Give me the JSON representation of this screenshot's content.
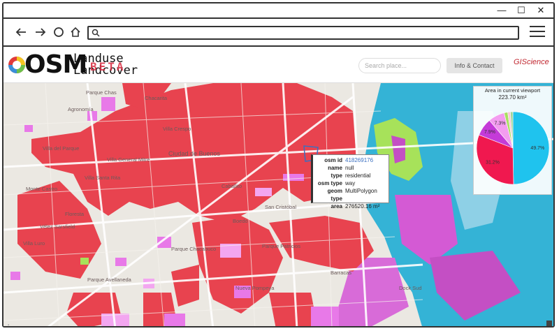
{
  "window": {
    "controls": [
      "—",
      "☐",
      "✕"
    ]
  },
  "browser": {
    "url": ""
  },
  "header": {
    "logo_osm": "OSM",
    "logo_line1": "Landuse",
    "logo_line2": "Landcover",
    "logo_beta": "BETA",
    "search_placeholder": "Search place...",
    "info_button": "Info & Contact",
    "partner_logo": "GIScience"
  },
  "map": {
    "labels": [
      "Parque Chas",
      "Agronomía",
      "Chacarita",
      "Villa Crespo",
      "Villa del Parque",
      "Villa General Mitre",
      "Villa Santa Rita",
      "Ciudad de Buenos",
      "Monte Castro",
      "Floresta",
      "Vélez Sarsfield",
      "Caballito",
      "San Cristóbal",
      "Boedo",
      "Villa Luro",
      "Parque Chacabuco",
      "Parque Patricios",
      "Parque Avellaneda",
      "Nueva Pompeya",
      "Barracas",
      "Dock Sud"
    ],
    "colors": {
      "residential": "#e8434f",
      "commercial": "#e879e8",
      "industrial": "#c44fc4",
      "water": "#34b3d6",
      "green": "#a7e25a",
      "roads": "#ffffff"
    }
  },
  "popup": {
    "rows": [
      {
        "key": "osm id",
        "value": "418269176"
      },
      {
        "key": "name",
        "value": "null"
      },
      {
        "key": "type",
        "value": "residential"
      },
      {
        "key": "osm type",
        "value": "way"
      },
      {
        "key": "geom type",
        "value": "MultiPolygon"
      },
      {
        "key": "area",
        "value": "276520.16 m²"
      }
    ]
  },
  "viewport_panel": {
    "title": "Area in current viewport",
    "area": "223.70 km²"
  },
  "chart_data": {
    "type": "pie",
    "title": "Area in current viewport",
    "subtitle": "223.70 km²",
    "slices": [
      {
        "label": "49.7%",
        "value": 49.7,
        "color": "#1fc3ee"
      },
      {
        "label": "31.2%",
        "value": 31.2,
        "color": "#f0184f"
      },
      {
        "label": "7.9%",
        "value": 7.9,
        "color": "#c43bd8"
      },
      {
        "label": "7.3%",
        "value": 7.3,
        "color": "#f39df0"
      },
      {
        "label": "",
        "value": 1.6,
        "color": "#a8e060"
      },
      {
        "label": "",
        "value": 1.2,
        "color": "#f8c9d6"
      },
      {
        "label": "",
        "value": 1.1,
        "color": "#9fd69a"
      }
    ]
  }
}
